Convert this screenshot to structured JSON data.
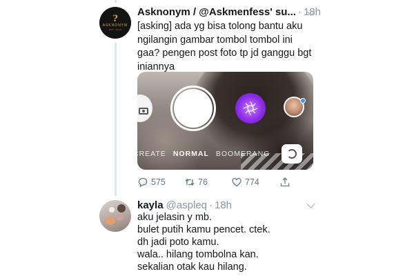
{
  "tweet1": {
    "display_name": "Asknonym / @Askmenfess' su...",
    "separator": "·",
    "time": "18h",
    "text": "[asking] ada yg bisa tolong bantu aku ngilangin gambar tombol tombol ini gaa? pengen post foto tp jd ganggu bgt iniannya",
    "avatar_label": "ASKNONYM",
    "media": {
      "modes": [
        "CREATE",
        "NORMAL",
        "BOOMERANG"
      ],
      "active_mode": "NORMAL"
    },
    "actions": {
      "replies": "575",
      "retweets": "76",
      "likes": "774"
    }
  },
  "tweet2": {
    "display_name": "kayla",
    "handle": "@aspleq",
    "separator": "·",
    "time": "18h",
    "text": "aku jelasin y mb.\nbulet putih kamu pencet. ctek.\ndh jadi poto kamu.\nwala.. hilang tombolna kan.\nsekalian otak kau hilang."
  },
  "colors": {
    "text": "#14171a",
    "secondary": "#657786",
    "thread_line": "#e1e8ed",
    "instagram_blue": "#3897f0",
    "filter_purple": "#8e2ee8"
  }
}
